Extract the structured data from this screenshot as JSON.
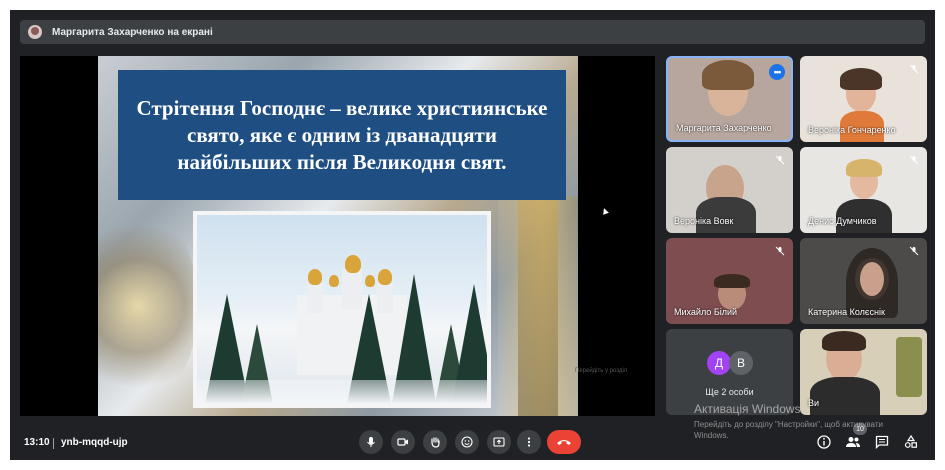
{
  "banner": {
    "presenter_text": "Маргарита Захарченко на екрані"
  },
  "slide": {
    "title": "Стрітення Господнє – велике християнське свято, яке є одним із дванадцяти найбільших після Великодня свят.",
    "hint": "Перейдіть у розділ"
  },
  "participants": [
    {
      "name": "Маргарита Захарченко",
      "muted": false,
      "speaking": true
    },
    {
      "name": "Вероніка Гончаренко",
      "muted": true
    },
    {
      "name": "Вероніка Вовк",
      "muted": true
    },
    {
      "name": "Денис Думчиков",
      "muted": true
    },
    {
      "name": "Михайло Білий",
      "muted": true
    },
    {
      "name": "Катерина Колєснік",
      "muted": true
    },
    {
      "name": "Ви",
      "muted": false
    }
  ],
  "others": {
    "initials": [
      "Д",
      "В"
    ],
    "label": "Ще 2 особи",
    "colors": [
      "#a142f4",
      "#5f6368"
    ]
  },
  "meeting": {
    "time": "13:10",
    "code": "ynb-mqqd-ujp"
  },
  "people_count": "10",
  "watermark": {
    "title": "Активація Windows",
    "subtitle": "Перейдіть до розділу \"Настройки\", щоб активувати Windows."
  },
  "colors": {
    "accent": "#8ab4f8",
    "end_call": "#ea4335",
    "slide_title_bg": "#1f4e83"
  }
}
